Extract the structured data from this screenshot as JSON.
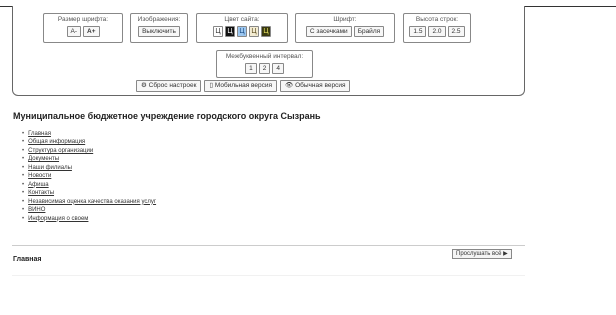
{
  "a11y_panel": {
    "font_size": {
      "label": "Размер шрифта:",
      "buttons": [
        "А-",
        "А+"
      ]
    },
    "images": {
      "label": "Изображения:",
      "button": "Выключить"
    },
    "site_color": {
      "label": "Цвет сайта:",
      "swatches": [
        {
          "text": "Ц",
          "style": "white"
        },
        {
          "text": "Ц",
          "style": "black"
        },
        {
          "text": "Ц",
          "style": "blue"
        },
        {
          "text": "Ц",
          "style": "beige"
        },
        {
          "text": "Ц",
          "style": "dark"
        }
      ]
    },
    "font": {
      "label": "Шрифт:",
      "buttons": [
        "С засечками",
        "Брайля"
      ]
    },
    "line_height": {
      "label": "Высота строк:",
      "buttons": [
        "1.5",
        "2.0",
        "2.5"
      ]
    },
    "spacing": {
      "label": "Межбуквенный интервал:",
      "buttons": [
        "1",
        "2",
        "4"
      ]
    },
    "footer": {
      "reset": "⚙ Сброс настроек",
      "mobile": "▯ Мобильная версия",
      "normal": "👁 Обычная версия"
    }
  },
  "site_title": "Муниципальное бюджетное учреждение городского округа Сызрань",
  "menu": [
    "Главная",
    "Общая информация",
    "Структура организации",
    "Документы",
    "Наши филиалы",
    "Новости",
    "Афиша",
    "Контакты",
    "Независимая оценка качества оказания услуг",
    "ВИНО",
    "Информация о своем"
  ],
  "listen_button": "Прослушать всё ▶",
  "page_heading": "Главная",
  "colors": {
    "border": "#666666",
    "accent_blue": "#9cc7f0"
  }
}
